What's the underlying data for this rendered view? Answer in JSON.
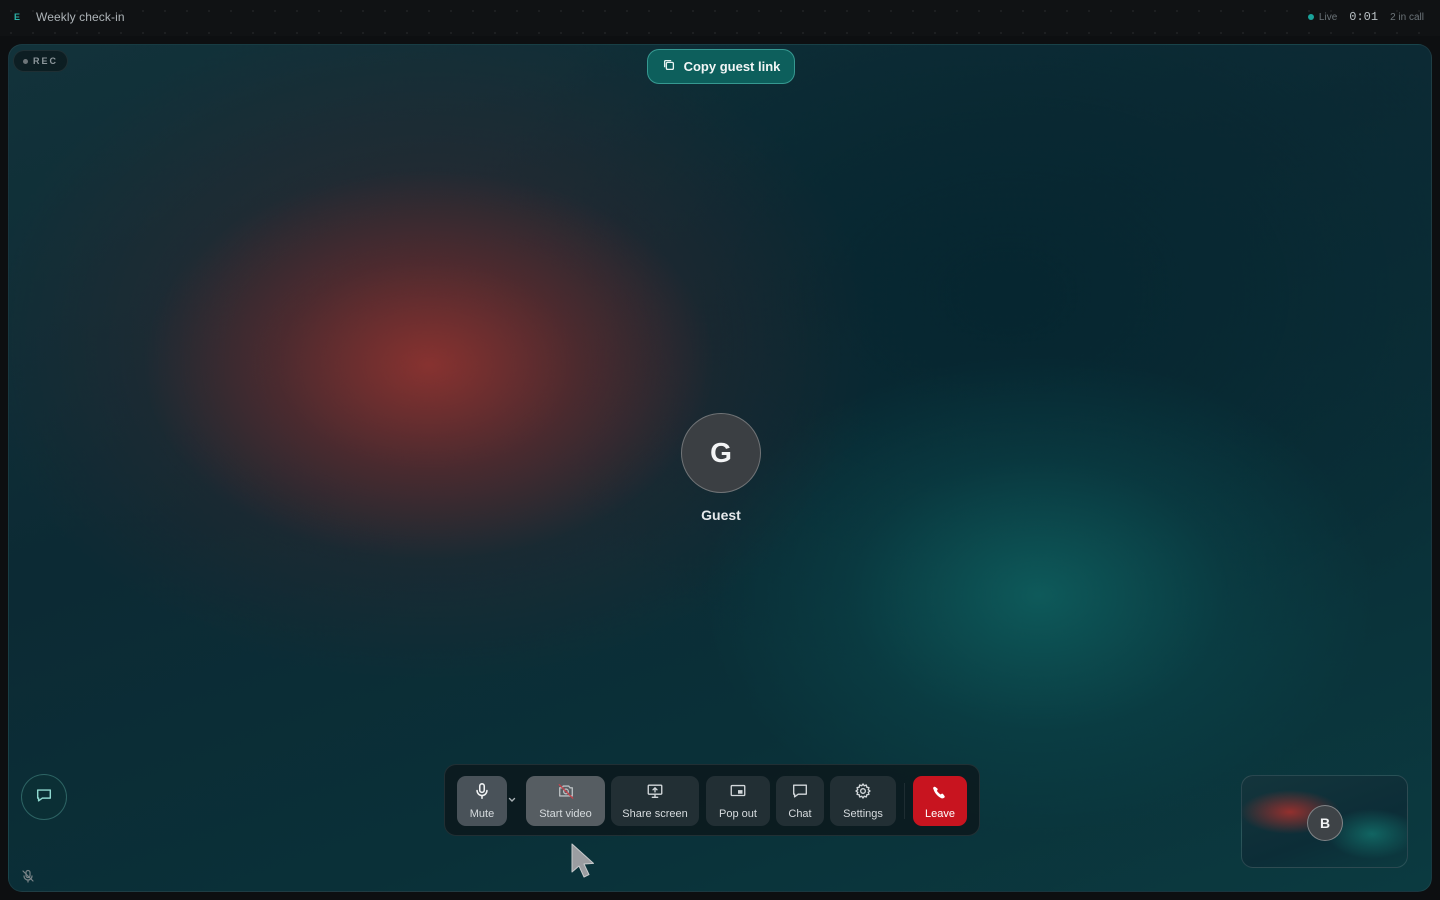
{
  "app": {
    "logo_letter": "E",
    "meeting_title": "Weekly check-in"
  },
  "status": {
    "live_label": "Live",
    "timer": "0:01",
    "participants": "2 in call"
  },
  "stage": {
    "rec_label": "REC",
    "copy_link_label": "Copy guest link",
    "main_participant": {
      "initial": "G",
      "name": "Guest"
    },
    "self_view": {
      "initial": "B"
    }
  },
  "controls": {
    "mute": "Mute",
    "start_video": "Start video",
    "share_screen": "Share screen",
    "pop_out": "Pop out",
    "chat": "Chat",
    "settings": "Settings",
    "leave": "Leave"
  },
  "colors": {
    "accent": "#0d5f5c",
    "live": "#1aa39b",
    "leave": "#c8141f"
  },
  "icons": {
    "copy": "copy-icon",
    "mic": "mic-icon",
    "camera_off": "camera-off-icon",
    "share": "share-screen-icon",
    "popout": "popout-icon",
    "chat": "chat-bubble-icon",
    "settings": "gear-icon",
    "leave": "phone-hangup-icon",
    "mic_muted": "mic-muted-icon"
  }
}
